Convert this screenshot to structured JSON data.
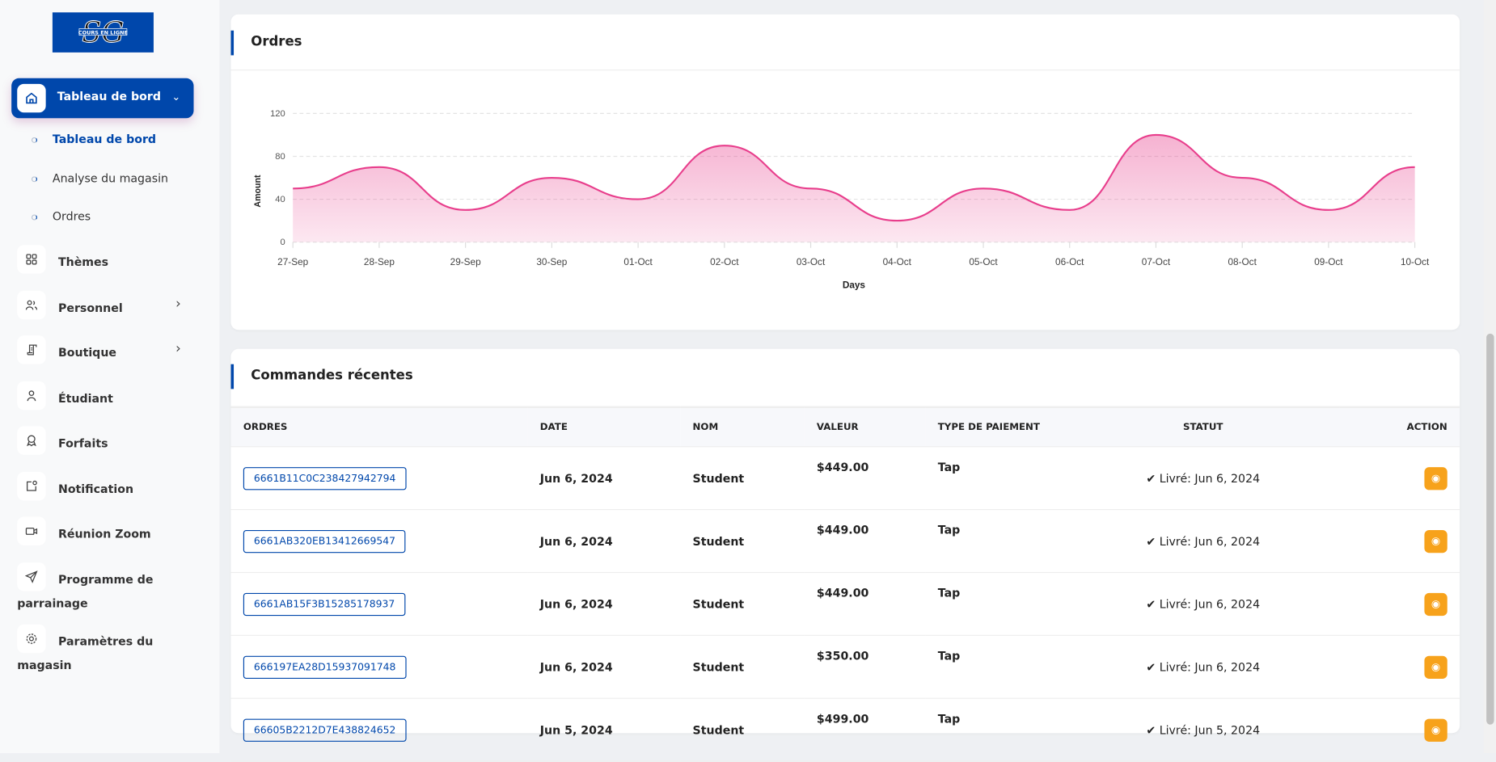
{
  "logo": {
    "text": "SG",
    "subtitle": "COURS EN LIGNE"
  },
  "sidebar": {
    "active": {
      "label": "Tableau de bord",
      "icon": "home-icon"
    },
    "submenu": [
      {
        "label": "Tableau de bord"
      },
      {
        "label": "Analyse du magasin"
      },
      {
        "label": "Ordres"
      }
    ],
    "items": [
      {
        "label": "Thèmes",
        "icon": "grid-icon"
      },
      {
        "label": "Personnel",
        "icon": "users-icon"
      },
      {
        "label": "Boutique",
        "icon": "receipt-icon"
      },
      {
        "label": "Étudiant",
        "icon": "user-icon"
      },
      {
        "label": "Forfaits",
        "icon": "award-icon"
      },
      {
        "label": "Notification",
        "icon": "notification-icon"
      },
      {
        "label": "Réunion Zoom",
        "icon": "video-icon"
      },
      {
        "label": "Programme de parrainage",
        "icon": "send-icon"
      },
      {
        "label": "Paramètres du magasin",
        "icon": "gear-icon"
      }
    ]
  },
  "orders_card": {
    "title": "Ordres"
  },
  "chart_data": {
    "type": "area",
    "title": "Ordres",
    "xlabel": "Days",
    "ylabel": "Amount",
    "ylim": [
      0,
      120
    ],
    "yticks": [
      0,
      40,
      80,
      120
    ],
    "categories": [
      "27-Sep",
      "28-Sep",
      "29-Sep",
      "30-Sep",
      "01-Oct",
      "02-Oct",
      "03-Oct",
      "04-Oct",
      "05-Oct",
      "06-Oct",
      "07-Oct",
      "08-Oct",
      "09-Oct",
      "10-Oct"
    ],
    "values": [
      50,
      70,
      30,
      60,
      40,
      90,
      50,
      20,
      50,
      30,
      100,
      60,
      30,
      70
    ],
    "color": "#e83e8c",
    "grid": true
  },
  "recent": {
    "title": "Commandes récentes",
    "headers": [
      "ORDRES",
      "DATE",
      "NOM",
      "VALEUR",
      "TYPE DE PAIEMENT",
      "STATUT",
      "ACTION"
    ],
    "rows": [
      {
        "id": "6661B11C0C238427942794",
        "date": "Jun 6, 2024",
        "name": "Student",
        "value": "$449.00",
        "payment": "Tap",
        "status": "Livré: Jun 6, 2024"
      },
      {
        "id": "6661AB320EB13412669547",
        "date": "Jun 6, 2024",
        "name": "Student",
        "value": "$449.00",
        "payment": "Tap",
        "status": "Livré: Jun 6, 2024"
      },
      {
        "id": "6661AB15F3B15285178937",
        "date": "Jun 6, 2024",
        "name": "Student",
        "value": "$449.00",
        "payment": "Tap",
        "status": "Livré: Jun 6, 2024"
      },
      {
        "id": "666197EA28D15937091748",
        "date": "Jun 6, 2024",
        "name": "Student",
        "value": "$350.00",
        "payment": "Tap",
        "status": "Livré: Jun 6, 2024"
      },
      {
        "id": "66605B2212D7E438824652",
        "date": "Jun 5, 2024",
        "name": "Student",
        "value": "$499.00",
        "payment": "Tap",
        "status": "Livré: Jun 5, 2024"
      }
    ]
  }
}
